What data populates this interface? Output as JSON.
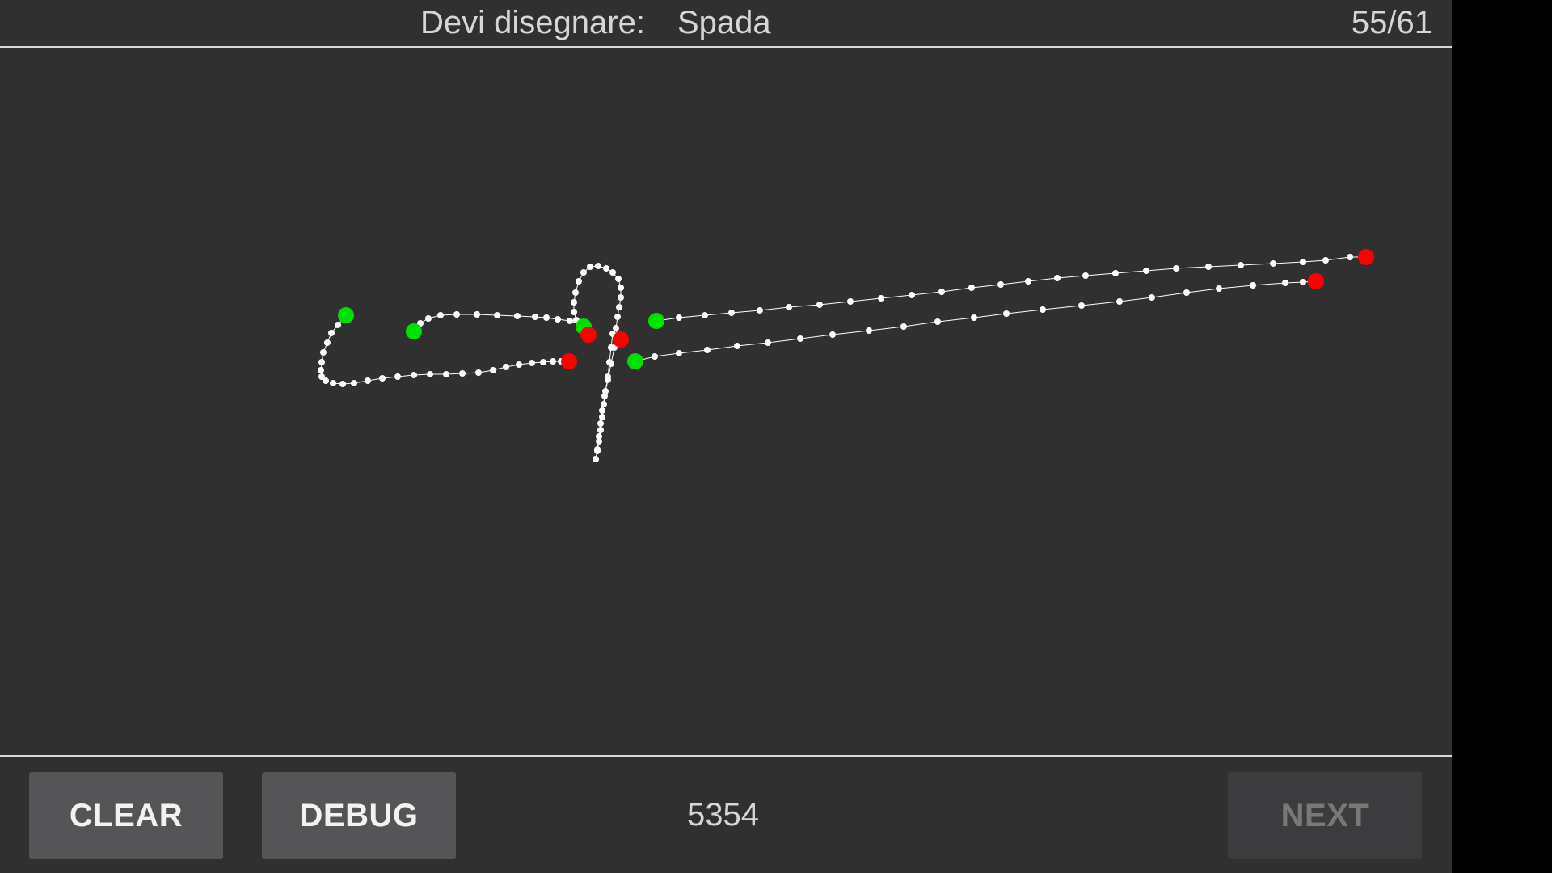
{
  "header": {
    "prompt_label": "Devi disegnare:",
    "prompt_word": "Spada",
    "progress": "55/61"
  },
  "footer": {
    "clear_label": "CLEAR",
    "debug_label": "DEBUG",
    "score": "5354",
    "next_label": "NEXT"
  },
  "colors": {
    "background": "#303030",
    "stroke_point": "#ffffff",
    "stroke_start": "#00e000",
    "stroke_end": "#ff0000"
  }
}
